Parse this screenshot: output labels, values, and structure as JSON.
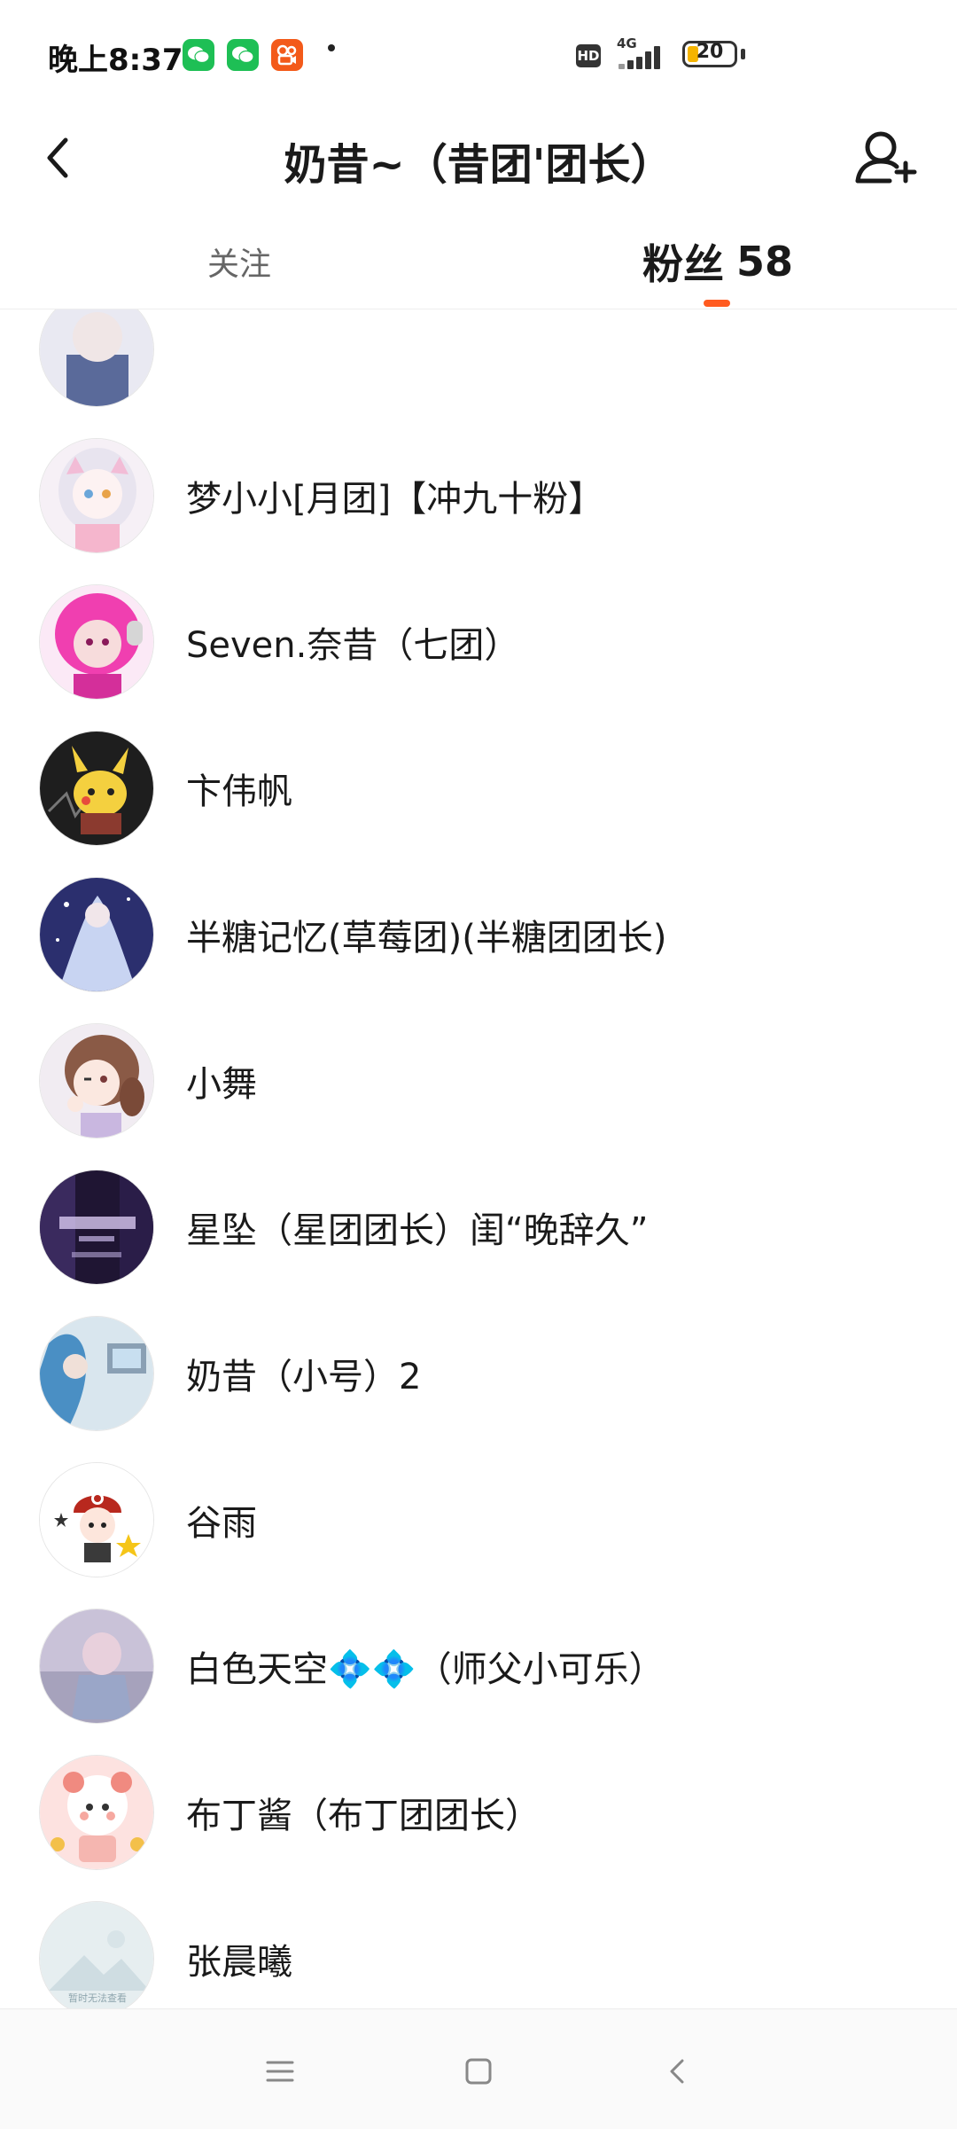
{
  "status_bar": {
    "time": "晚上8:37",
    "network": "4G",
    "hd": "HD",
    "battery": "20",
    "icons": [
      "wechat-icon",
      "wechat-icon",
      "kuaishou-icon"
    ],
    "battery_color": "#f5b400"
  },
  "header": {
    "title": "奶昔~（昔团'团长）",
    "back_icon": "back-arrow-icon",
    "add_icon": "add-user-icon"
  },
  "tabs": {
    "following_label": "关注",
    "fans_label": "粉丝",
    "fans_count": "58",
    "accent_color": "#ff5a1f"
  },
  "fans": [
    {
      "name": ""
    },
    {
      "name": "梦小小[月团]【冲九十粉】"
    },
    {
      "name": "Seven.奈昔（七团）"
    },
    {
      "name": "卞伟帆"
    },
    {
      "name": "半糖记忆(草莓团)(半糖团团长)"
    },
    {
      "name": "小舞"
    },
    {
      "name": "星坠（星团团长）闺“晚辞久”"
    },
    {
      "name": "奶昔（小号）2"
    },
    {
      "name": "谷雨"
    },
    {
      "name": "白色天空💠💠（师父小可乐）"
    },
    {
      "name": "布丁酱（布丁团团长）"
    },
    {
      "name": "张晨曦"
    },
    {
      "name": ""
    }
  ],
  "placeholder_avatar_text": "暂时无法查看",
  "nav_bar": {
    "icons": [
      "menu-icon",
      "home-square-icon",
      "back-triangle-icon"
    ]
  }
}
